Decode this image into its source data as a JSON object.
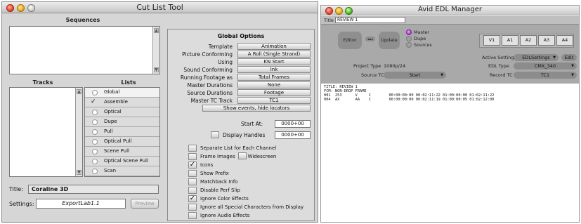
{
  "cut_list": {
    "title": "Cut List Tool",
    "sequences_label": "Sequences",
    "tracks_label": "Tracks",
    "lists_label": "Lists",
    "lists": [
      {
        "label": "Global",
        "selected": true,
        "checked": false
      },
      {
        "label": "Assemble",
        "selected": false,
        "checked": true
      },
      {
        "label": "Optical",
        "selected": false,
        "checked": false
      },
      {
        "label": "Dupe",
        "selected": false,
        "checked": false
      },
      {
        "label": "Pull",
        "selected": false,
        "checked": false
      },
      {
        "label": "Optical Pull",
        "selected": false,
        "checked": false
      },
      {
        "label": "Scene Pull",
        "selected": false,
        "checked": false
      },
      {
        "label": "Optical Scene Pull",
        "selected": false,
        "checked": false
      },
      {
        "label": "Scan",
        "selected": false,
        "checked": false
      }
    ],
    "title_label": "Title:",
    "title_value": "Coraline 3D",
    "settings_label": "Settings:",
    "settings_value": "ExportLab1.1",
    "preview_label": "Preview",
    "global_options": {
      "heading": "Global Options",
      "rows": [
        {
          "label": "Template",
          "value": "Animation"
        },
        {
          "label": "Picture Conforming",
          "value": "A Roll (Single Strand)"
        },
        {
          "label": "Using",
          "value": "KN Start"
        },
        {
          "label": "Sound Conforming",
          "value": "Ink"
        },
        {
          "label": "Running Footage as",
          "value": "Total Frames"
        },
        {
          "label": "Master Durations",
          "value": "None"
        },
        {
          "label": "Source Durations",
          "value": "Footage"
        },
        {
          "label": "Master TC Track",
          "value": "TC1"
        }
      ],
      "show_events_label": "Show events, hide locators",
      "start_at_label": "Start At:",
      "start_at_value": "0000+00",
      "display_handles_label": "Display Handles",
      "display_handles_value": "0000+00",
      "checkboxes": [
        {
          "label": "Separate List for Each Channel",
          "checked": false
        },
        {
          "label": "Frame Images",
          "checked": false,
          "extra_label": "Widescreen"
        },
        {
          "label": "Icons",
          "checked": true
        },
        {
          "label": "Show Prefix",
          "checked": false
        },
        {
          "label": "Matchback Info",
          "checked": false
        },
        {
          "label": "Disable Perf Slip",
          "checked": false
        },
        {
          "label": "Ignore Color Effects",
          "checked": true
        },
        {
          "label": "Ignore all Special Characters from Display",
          "checked": false
        },
        {
          "label": "Ignore Audio Effects",
          "checked": false
        }
      ],
      "check_glyph": "✓"
    }
  },
  "edl": {
    "title": "Avid EDL Manager",
    "title_label": "Title",
    "title_value": "REVIEW 1",
    "editor_label": "Editor",
    "update_label": "Update",
    "radio_options": [
      {
        "label": "Master",
        "selected": true
      },
      {
        "label": "Dupe",
        "selected": false
      },
      {
        "label": "Sources",
        "selected": false
      }
    ],
    "tracks": [
      "V1",
      "A1",
      "A2",
      "A3",
      "A4"
    ],
    "active_setting_label": "Active Setting",
    "active_setting_value": "EDLSettings",
    "edit_label": "Edit",
    "project_type_label": "Project Type",
    "project_type_value": "1080p/24",
    "edl_type_label": "EDL Type",
    "edl_type_value": "CMX_340",
    "source_tc_label": "Source TC",
    "source_tc_value": "Start",
    "record_tc_label": "Record TC",
    "record_tc_value": "TC1",
    "edl_lines": [
      "TITLE: REVIEW 1",
      "FCM: NON-DROP FRAME",
      "001  253      V     C        00:00:00:00 00:02:11:22 01:00:00:00 01:02:11:22",
      "004  AX       AA    C        00:00:00:00 00:02:11:19 01:00:00:05 01:02:12:00"
    ]
  }
}
